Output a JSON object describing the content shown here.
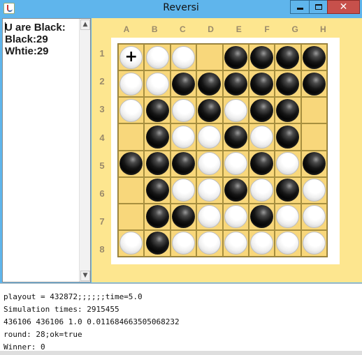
{
  "window": {
    "title": "Reversi",
    "close_glyph": "✕"
  },
  "info": {
    "line1": "U are Black:",
    "line2": "Black:29",
    "line3": "Whtie:29"
  },
  "scrollbar": {
    "up_glyph": "▲",
    "down_glyph": "▼"
  },
  "board": {
    "columns": [
      "A",
      "B",
      "C",
      "D",
      "E",
      "F",
      "G",
      "H"
    ],
    "rows": [
      "1",
      "2",
      "3",
      "4",
      "5",
      "6",
      "7",
      "8"
    ],
    "cells": [
      [
        "W",
        "W",
        "W",
        "",
        "B",
        "B",
        "B",
        "B"
      ],
      [
        "W",
        "W",
        "B",
        "B",
        "B",
        "B",
        "B",
        "B"
      ],
      [
        "W",
        "B",
        "W",
        "B",
        "W",
        "B",
        "B",
        ""
      ],
      [
        "",
        "B",
        "W",
        "W",
        "B",
        "W",
        "B",
        ""
      ],
      [
        "B",
        "B",
        "B",
        "W",
        "W",
        "B",
        "W",
        "B"
      ],
      [
        "",
        "B",
        "W",
        "W",
        "B",
        "W",
        "B",
        "W"
      ],
      [
        "",
        "B",
        "B",
        "W",
        "W",
        "B",
        "W",
        "W"
      ],
      [
        "W",
        "B",
        "W",
        "W",
        "W",
        "W",
        "W",
        "W"
      ]
    ],
    "cursor": {
      "row": 0,
      "col": 0,
      "glyph": "+"
    },
    "colors": {
      "board": "#f8d77b",
      "grid": "#a78f3f",
      "panel": "#fde68f"
    }
  },
  "console": {
    "lines": [
      "playout = 432872;;;;;;time=5.0",
      "Simulation times: 2915455",
      "436106 436106 1.0 0.011684663505068232",
      "round: 28;ok=true",
      "Winner: 0"
    ]
  }
}
